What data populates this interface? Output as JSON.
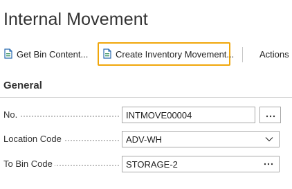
{
  "page": {
    "title": "Internal Movement"
  },
  "actions": {
    "get_bin_content": {
      "label": "Get Bin Content...",
      "icon": "document-icon"
    },
    "create_inventory_movement": {
      "label": "Create Inventory Movement...",
      "icon": "document-icon",
      "highlighted": true
    },
    "actions_menu": {
      "label": "Actions"
    }
  },
  "general": {
    "title": "General",
    "fields": {
      "no": {
        "label": "No.",
        "value": "INTMOVE00004"
      },
      "location_code": {
        "label": "Location Code",
        "value": "ADV-WH"
      },
      "to_bin_code": {
        "label": "To Bin Code",
        "value": "STORAGE-2"
      }
    }
  },
  "colors": {
    "highlight": "#f0a60a",
    "icon_green": "#2e8b57",
    "icon_blue": "#2b6cb0",
    "border": "#a8a8a8"
  }
}
